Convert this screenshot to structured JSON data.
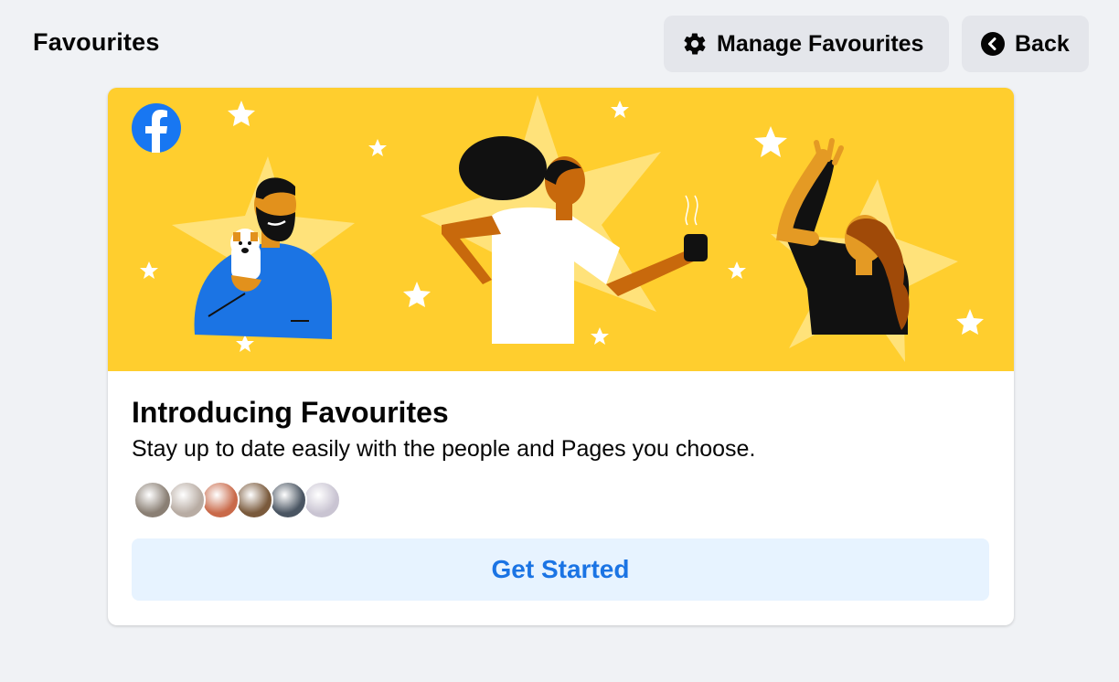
{
  "header": {
    "title": "Favourites",
    "manage_button": {
      "label": "Manage Favourites",
      "icon": "gear-icon"
    },
    "back_button": {
      "label": "Back",
      "icon": "chevron-left-circle-icon"
    }
  },
  "card": {
    "banner": {
      "logo": "facebook-logo",
      "background": "#ffce2e"
    },
    "title": "Introducing Favourites",
    "subtitle": "Stay up to date easily with the people and Pages you choose.",
    "avatars": [
      {
        "name": "avatar-1",
        "color": "#8a7f74"
      },
      {
        "name": "avatar-2",
        "color": "#b8aca3"
      },
      {
        "name": "avatar-3",
        "color": "#c96a4a"
      },
      {
        "name": "avatar-4",
        "color": "#7a5a3c"
      },
      {
        "name": "avatar-5",
        "color": "#4a5562"
      },
      {
        "name": "avatar-6",
        "color": "#c9c4d2"
      }
    ],
    "cta_label": "Get Started"
  },
  "colors": {
    "accent": "#1b74e4",
    "cta_background": "#e7f3ff",
    "page_background": "#f0f2f5",
    "button_background": "#e4e6eb"
  }
}
